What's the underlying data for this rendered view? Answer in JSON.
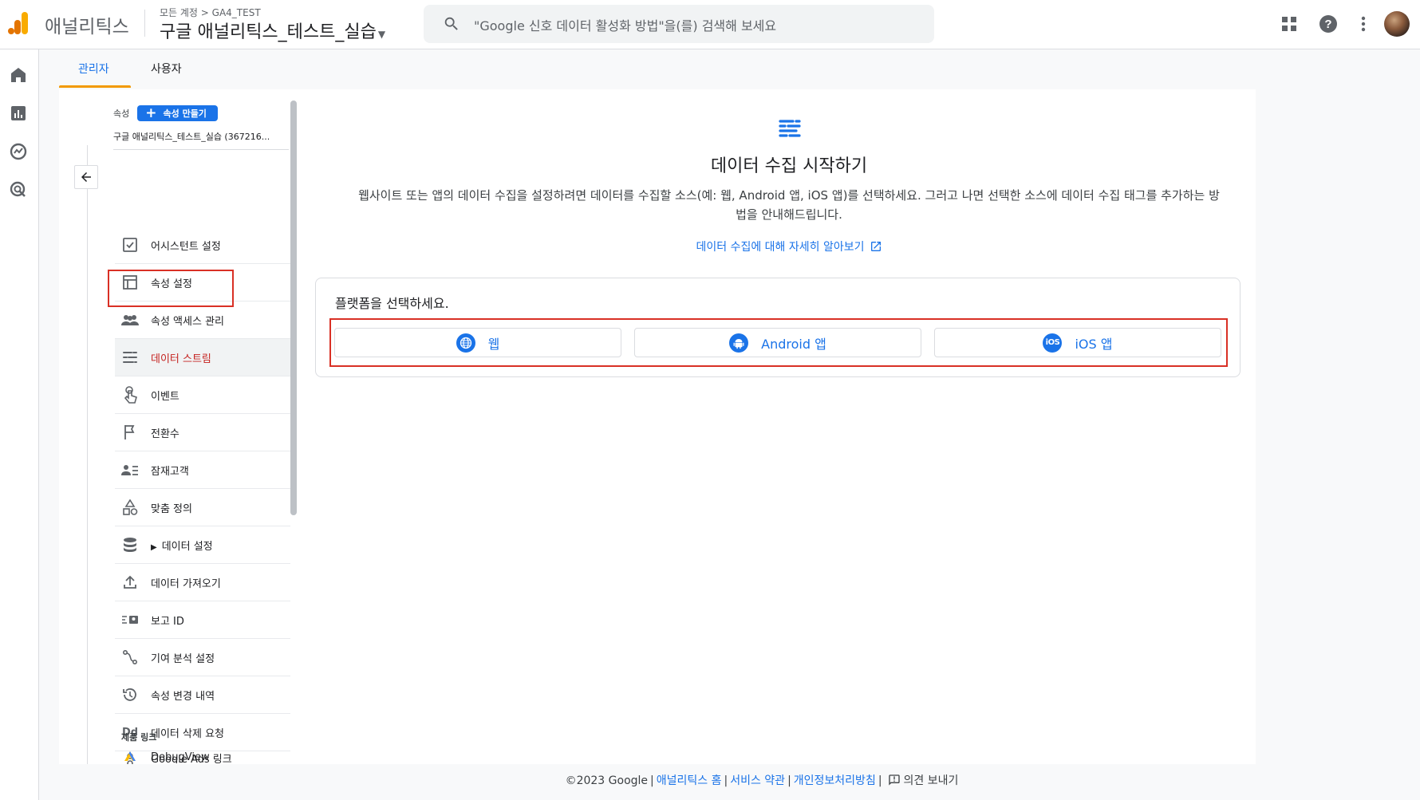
{
  "header": {
    "brand": "애널리틱스",
    "breadcrumb": "모든 계정 > GA4_TEST",
    "property_title": "구글 애널리틱스_테스트_실습",
    "search_placeholder": "\"Google 신호 데이터 활성화 방법\"을(를) 검색해 보세요"
  },
  "tabs": [
    {
      "label": "관리자",
      "active": true
    },
    {
      "label": "사용자",
      "active": false
    }
  ],
  "property_panel": {
    "label": "속성",
    "create_button": "속성 만들기",
    "property_name": "구글 애널리틱스_테스트_실습 (367216..."
  },
  "nav_items": [
    {
      "label": "어시스턴트 설정",
      "icon": "checklist-icon"
    },
    {
      "label": "속성 설정",
      "icon": "layout-icon"
    },
    {
      "label": "속성 액세스 관리",
      "icon": "people-icon"
    },
    {
      "label": "데이터 스트림",
      "icon": "stream-icon",
      "active": true
    },
    {
      "label": "이벤트",
      "icon": "touch-icon"
    },
    {
      "label": "전환수",
      "icon": "flag-icon"
    },
    {
      "label": "잠재고객",
      "icon": "audience-icon"
    },
    {
      "label": "맞춤 정의",
      "icon": "shapes-icon"
    },
    {
      "label": "데이터 설정",
      "icon": "database-icon",
      "expandable": true
    },
    {
      "label": "데이터 가져오기",
      "icon": "upload-icon"
    },
    {
      "label": "보고 ID",
      "icon": "report-id-icon"
    },
    {
      "label": "기여 분석 설정",
      "icon": "attribution-icon"
    },
    {
      "label": "속성 변경 내역",
      "icon": "history-icon"
    },
    {
      "label": "데이터 삭제 요청",
      "icon": "dd-icon"
    },
    {
      "label": "DebugView",
      "icon": "debug-icon"
    }
  ],
  "product_links": {
    "label": "제품 링크",
    "first_item": "Google Ads 링크"
  },
  "main": {
    "title": "데이터 수집 시작하기",
    "description": "웹사이트 또는 앱의 데이터 수집을 설정하려면 데이터를 수집할 소스(예: 웹, Android 앱, iOS 앱)를 선택하세요. 그러고 나면 선택한 소스에 데이터 수집 태그를 추가하는 방법을 안내해드립니다.",
    "learn_more": "데이터 수집에 대해 자세히 알아보기",
    "platform_label": "플랫폼을 선택하세요.",
    "platforms": [
      {
        "label": "웹",
        "icon": "globe-icon"
      },
      {
        "label": "Android 앱",
        "icon": "android-icon"
      },
      {
        "label": "iOS 앱",
        "icon": "ios-icon"
      }
    ]
  },
  "footer": {
    "copyright": "©2023 Google",
    "links": [
      "애널리틱스 홈",
      "서비스 약관",
      "개인정보처리방침"
    ],
    "feedback": "의견 보내기"
  },
  "colors": {
    "accent": "#1a73e8",
    "highlight": "#d93025",
    "tab_underline": "#f29900"
  }
}
